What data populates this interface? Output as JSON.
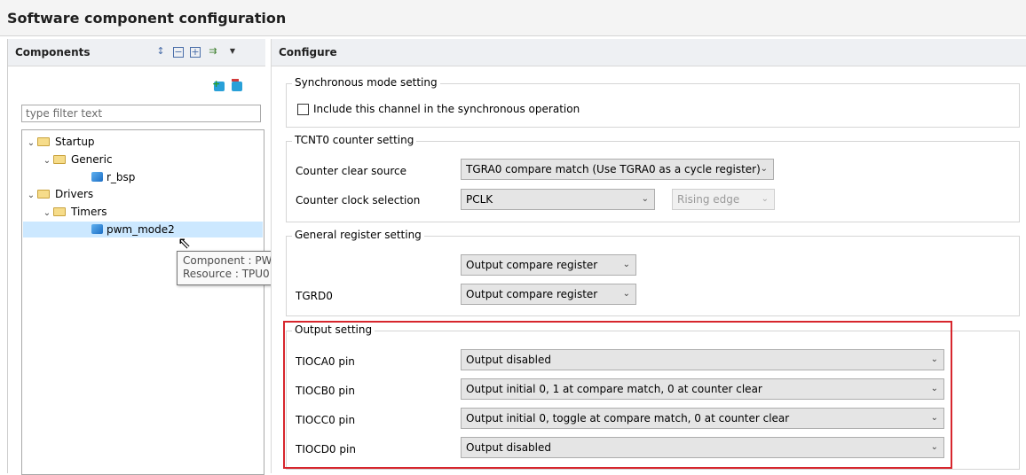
{
  "title": "Software component configuration",
  "components_panel": {
    "header": "Components",
    "toolbar_icons": [
      "sort-az-icon",
      "collapse-all-icon",
      "expand-all-icon",
      "filter-icon",
      "dropdown-arrow-icon"
    ],
    "action_icons": [
      "add-component-icon",
      "remove-component-icon"
    ],
    "filter_placeholder": "type filter text",
    "tree": [
      {
        "label": "Startup",
        "type": "folder"
      },
      {
        "label": "Generic",
        "type": "folder"
      },
      {
        "label": "r_bsp",
        "type": "component"
      },
      {
        "label": "Drivers",
        "type": "folder"
      },
      {
        "label": "Timers",
        "type": "folder"
      },
      {
        "label": "pwm_mode2",
        "type": "component",
        "selected": true
      }
    ],
    "tooltip": {
      "line1": "Component : PWM Mode Timer",
      "line2": "Resource : TPU0"
    }
  },
  "configure_panel": {
    "header": "Configure",
    "sync": {
      "legend": "Synchronous mode setting",
      "checkbox_label": "Include this channel in the synchronous operation",
      "checked": false
    },
    "tcnt": {
      "legend": "TCNT0 counter setting",
      "clear_label": "Counter clear source",
      "clear_value": "TGRA0 compare match (Use TGRA0 as a cycle register)",
      "clock_label": "Counter clock selection",
      "clock_value": "PCLK",
      "edge_value": "Rising edge"
    },
    "general": {
      "legend": "General register setting",
      "tgrc_value": "Output compare register",
      "tgrd_label": "TGRD0",
      "tgrd_value": "Output compare register"
    },
    "output": {
      "legend": "Output setting",
      "rows": [
        {
          "label": "TIOCA0 pin",
          "value": "Output disabled"
        },
        {
          "label": "TIOCB0 pin",
          "value": "Output initial 0, 1 at compare match, 0 at counter clear"
        },
        {
          "label": "TIOCC0 pin",
          "value": "Output initial 0, toggle at compare match, 0 at counter clear"
        },
        {
          "label": "TIOCD0 pin",
          "value": "Output disabled"
        }
      ]
    }
  },
  "colors": {
    "highlight": "#d7262d",
    "selection": "#cce8ff"
  }
}
